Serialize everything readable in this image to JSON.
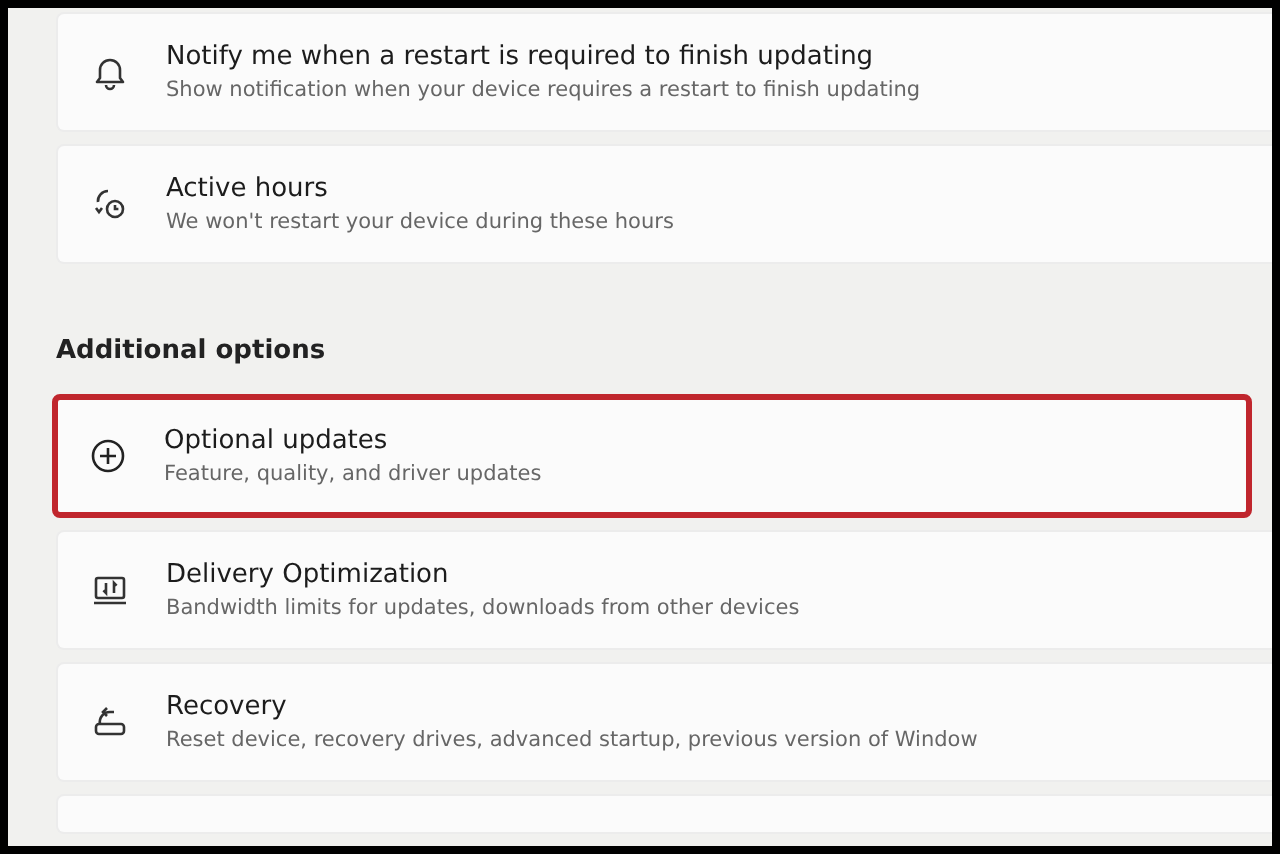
{
  "sections": [
    {
      "items": [
        {
          "title": "Notify me when a restart is required to finish updating",
          "description": "Show notification when your device requires a restart to finish updating",
          "highlighted": false
        },
        {
          "title": "Active hours",
          "description": "We won't restart your device during these hours",
          "highlighted": false
        }
      ]
    },
    {
      "heading": "Additional options",
      "items": [
        {
          "title": "Optional updates",
          "description": "Feature, quality, and driver updates",
          "highlighted": true
        },
        {
          "title": "Delivery Optimization",
          "description": "Bandwidth limits for updates, downloads from other devices",
          "highlighted": false
        },
        {
          "title": "Recovery",
          "description": "Reset device, recovery drives, advanced startup, previous version of Window",
          "highlighted": false
        }
      ]
    }
  ]
}
